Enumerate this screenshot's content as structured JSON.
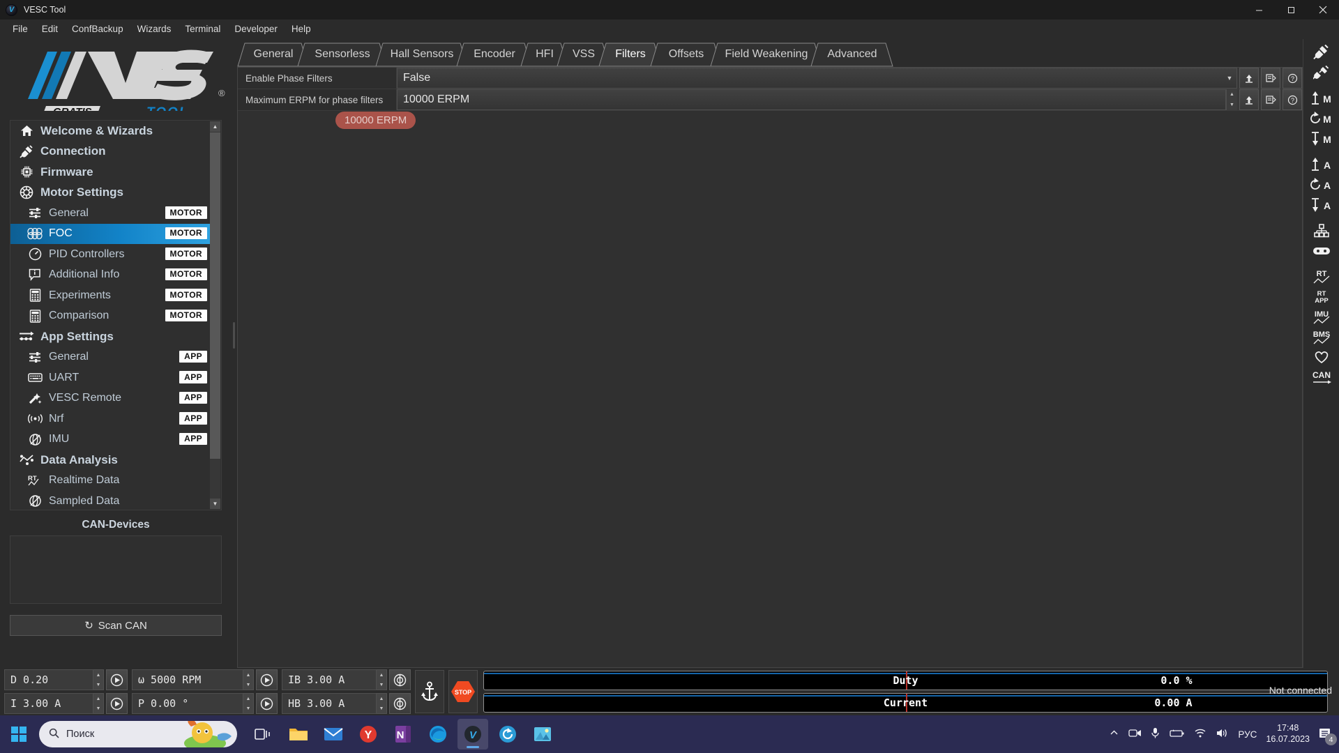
{
  "window": {
    "title": "VESC Tool",
    "logo_main": "VESC",
    "logo_sub": "TOOL",
    "logo_tag": "GRATIS",
    "registered_mark": "®",
    "minimize": "minimize-icon",
    "maximize": "maximize-icon",
    "close": "close-icon"
  },
  "menubar": {
    "items": [
      {
        "label": "File"
      },
      {
        "label": "Edit"
      },
      {
        "label": "ConfBackup"
      },
      {
        "label": "Wizards"
      },
      {
        "label": "Terminal"
      },
      {
        "label": "Developer"
      },
      {
        "label": "Help"
      }
    ]
  },
  "sidebar": {
    "items": [
      {
        "label": "Welcome & Wizards",
        "icon": "home-icon",
        "level": "top",
        "badge": "",
        "active": false
      },
      {
        "label": "Connection",
        "icon": "plug-icon",
        "level": "top",
        "badge": "",
        "active": false
      },
      {
        "label": "Firmware",
        "icon": "chip-icon",
        "level": "top",
        "badge": "",
        "active": false
      },
      {
        "label": "Motor Settings",
        "icon": "gear-icon",
        "level": "top",
        "badge": "",
        "active": false
      },
      {
        "label": "General",
        "icon": "sliders-icon",
        "level": "sub",
        "badge": "MOTOR",
        "active": false
      },
      {
        "label": "FOC",
        "icon": "waveform-icon",
        "level": "sub",
        "badge": "MOTOR",
        "active": true
      },
      {
        "label": "PID Controllers",
        "icon": "gauge-icon",
        "level": "sub",
        "badge": "MOTOR",
        "active": false
      },
      {
        "label": "Additional Info",
        "icon": "info-box-icon",
        "level": "sub",
        "badge": "MOTOR",
        "active": false
      },
      {
        "label": "Experiments",
        "icon": "calculator-icon",
        "level": "sub",
        "badge": "MOTOR",
        "active": false
      },
      {
        "label": "Comparison",
        "icon": "calculator-icon",
        "level": "sub",
        "badge": "MOTOR",
        "active": false
      },
      {
        "label": "App Settings",
        "icon": "arrow-nodes-icon",
        "level": "top",
        "badge": "",
        "active": false
      },
      {
        "label": "General",
        "icon": "sliders-icon",
        "level": "sub",
        "badge": "APP",
        "active": false
      },
      {
        "label": "UART",
        "icon": "keyboard-icon",
        "level": "sub",
        "badge": "APP",
        "active": false
      },
      {
        "label": "VESC Remote",
        "icon": "wand-icon",
        "level": "sub",
        "badge": "APP",
        "active": false
      },
      {
        "label": "Nrf",
        "icon": "rf-signal-icon",
        "level": "sub",
        "badge": "APP",
        "active": false
      },
      {
        "label": "IMU",
        "icon": "imu-icon",
        "level": "sub",
        "badge": "APP",
        "active": false
      },
      {
        "label": "Data Analysis",
        "icon": "analysis-icon",
        "level": "top",
        "badge": "",
        "active": false
      },
      {
        "label": "Realtime Data",
        "icon": "rt-icon",
        "level": "sub",
        "badge": "",
        "active": false
      },
      {
        "label": "Sampled Data",
        "icon": "sampled-icon",
        "level": "sub",
        "badge": "",
        "active": false
      }
    ],
    "can_devices_title": "CAN-Devices",
    "scan_can_label": "Scan CAN",
    "scan_can_icon": "refresh-icon"
  },
  "tabs": [
    {
      "label": "General",
      "selected": false
    },
    {
      "label": "Sensorless",
      "selected": false
    },
    {
      "label": "Hall Sensors",
      "selected": false
    },
    {
      "label": "Encoder",
      "selected": false
    },
    {
      "label": "HFI",
      "selected": false
    },
    {
      "label": "VSS",
      "selected": false
    },
    {
      "label": "Filters",
      "selected": true
    },
    {
      "label": "Offsets",
      "selected": false
    },
    {
      "label": "Field Weakening",
      "selected": false
    },
    {
      "label": "Advanced",
      "selected": false
    }
  ],
  "settings": {
    "rows": [
      {
        "label": "Enable Phase Filters",
        "value": "False",
        "type": "dropdown",
        "buttons": [
          "upload-icon",
          "read-icon",
          "help-icon"
        ]
      },
      {
        "label": "Maximum ERPM for phase filters",
        "value": "10000 ERPM",
        "type": "spinbox",
        "buttons": [
          "upload-icon",
          "read-icon",
          "help-icon"
        ]
      }
    ],
    "tooltip": "10000 ERPM"
  },
  "right_toolbar": {
    "items": [
      {
        "icon": "connect-plug-icon",
        "label": ""
      },
      {
        "icon": "disconnect-plug-icon",
        "label": ""
      },
      {
        "icon": "upload-motor-icon",
        "label": "↑M"
      },
      {
        "icon": "refresh-motor-icon",
        "label": "↻M"
      },
      {
        "icon": "download-motor-icon",
        "label": "↓M"
      },
      {
        "icon": "upload-app-icon",
        "label": "↑A"
      },
      {
        "icon": "refresh-app-icon",
        "label": "↻A"
      },
      {
        "icon": "download-app-icon",
        "label": "↓A"
      },
      {
        "icon": "can-nodes-icon",
        "label": ""
      },
      {
        "icon": "gamepad-icon",
        "label": ""
      },
      {
        "icon": "realtime-icon",
        "label": "RT"
      },
      {
        "icon": "realtime-app-icon",
        "label": "RT APP"
      },
      {
        "icon": "imu-plot-icon",
        "label": "IMU"
      },
      {
        "icon": "bms-plot-icon",
        "label": "BMS"
      },
      {
        "icon": "heart-icon",
        "label": ""
      },
      {
        "icon": "can-icon",
        "label": "CAN"
      }
    ]
  },
  "bottom_controls": {
    "fields": [
      {
        "name": "duty",
        "value": "D 0.20",
        "button": "play-icon"
      },
      {
        "name": "current",
        "value": "I 3.00 A",
        "button": "play-icon"
      },
      {
        "name": "rpm",
        "value": "ω 5000 RPM",
        "button": "play-icon"
      },
      {
        "name": "position",
        "value": "P 0.00 °",
        "button": "play-icon"
      },
      {
        "name": "brake-current",
        "value": "IB 3.00 A",
        "button": "brake-icon"
      },
      {
        "name": "handbrake-current",
        "value": "HB 3.00 A",
        "button": "brake-icon"
      }
    ],
    "anchor_button": "anchor-icon",
    "stop_button": "STOP",
    "bars": [
      {
        "name": "Duty",
        "value": "0.0 %"
      },
      {
        "name": "Current",
        "value": "0.00 A"
      }
    ],
    "status": "Not connected"
  },
  "taskbar": {
    "start_icon": "windows-icon",
    "search_placeholder": "Поиск",
    "search_icon": "search-icon",
    "apps": [
      {
        "name": "task-view-icon",
        "active": false
      },
      {
        "name": "file-explorer-icon",
        "active": false
      },
      {
        "name": "mail-icon",
        "active": false
      },
      {
        "name": "yandex-icon",
        "active": false
      },
      {
        "name": "onenote-icon",
        "active": false
      },
      {
        "name": "edge-icon",
        "active": false
      },
      {
        "name": "vesc-tool-icon",
        "active": true
      },
      {
        "name": "sync-icon",
        "active": false
      },
      {
        "name": "photos-icon",
        "active": false
      }
    ],
    "tray": {
      "chevron": "chevron-up-icon",
      "camera": "camera-icon",
      "mic": "microphone-icon",
      "battery": "battery-icon",
      "wifi": "wifi-icon",
      "volume": "volume-icon",
      "language": "РУС",
      "time": "17:48",
      "date": "16.07.2023",
      "notifications_icon": "notification-icon",
      "notifications_count": "4"
    }
  },
  "colors": {
    "accent": "#1283c8",
    "panel": "#303030",
    "background": "#2b2b2b",
    "tooltip": "#b4564c",
    "stop": "#f04a21"
  }
}
